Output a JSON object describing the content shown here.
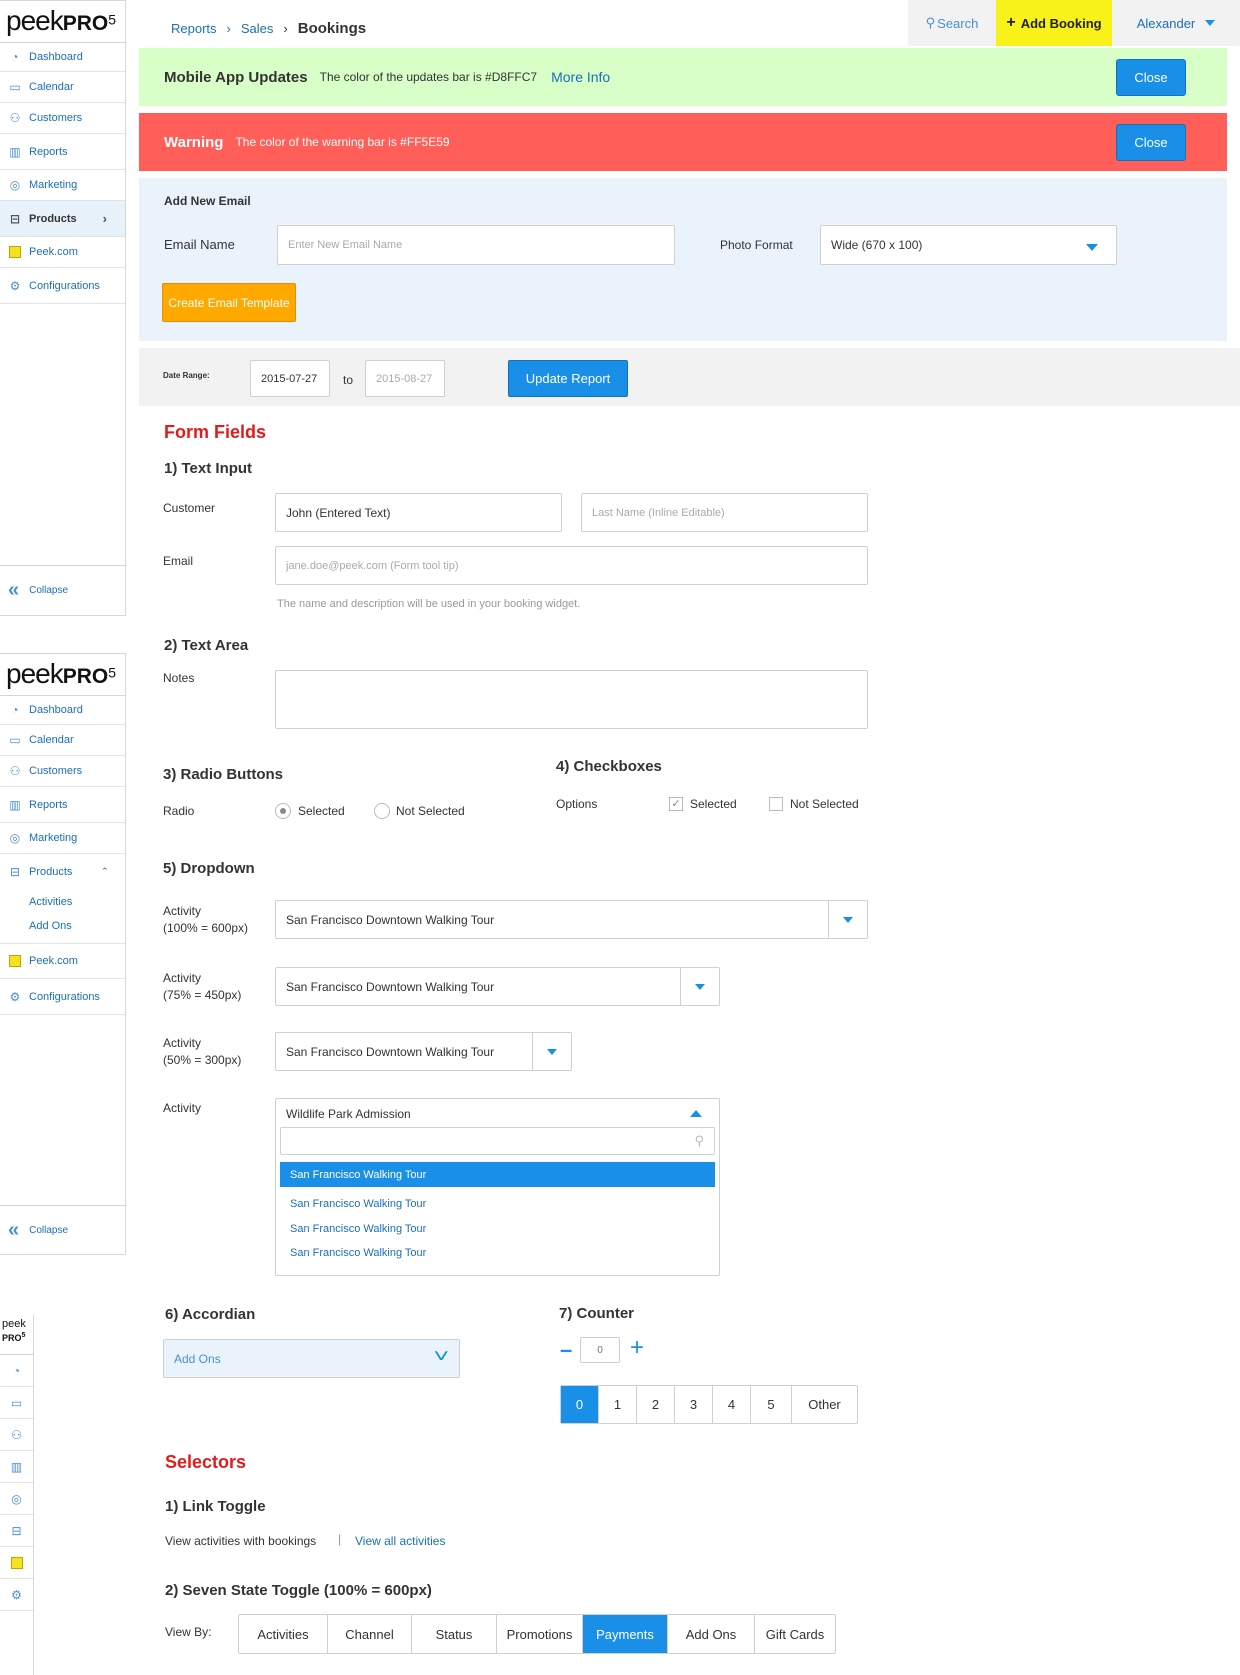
{
  "logo": {
    "peek": "peek",
    "pro": "PRO",
    "version": "5",
    "mini_peek": "peek",
    "mini_pro": "PRO"
  },
  "sidebar": {
    "items": [
      {
        "label": "Dashboard",
        "icon": "dashboard-icon"
      },
      {
        "label": "Calendar",
        "icon": "calendar-icon"
      },
      {
        "label": "Customers",
        "icon": "customers-icon"
      },
      {
        "label": "Reports",
        "icon": "reports-icon"
      },
      {
        "label": "Marketing",
        "icon": "marketing-icon"
      },
      {
        "label": "Products",
        "icon": "products-icon"
      },
      {
        "label": "Peek.com",
        "icon": "peek-com-icon"
      },
      {
        "label": "Configurations",
        "icon": "gear-icon"
      }
    ],
    "sub_items": [
      "Activities",
      "Add Ons"
    ],
    "collapse": "Collapse"
  },
  "breadcrumb": {
    "items": [
      "Reports",
      "Sales"
    ],
    "current": "Bookings"
  },
  "topbar": {
    "search": "Search",
    "add_booking": "Add Booking",
    "user": "Alexander"
  },
  "updates_bar": {
    "title": "Mobile App Updates",
    "message": "The color of the updates bar is #D8FFC7",
    "link": "More Info",
    "close": "Close",
    "color": "#D8FFC7"
  },
  "warning_bar": {
    "title": "Warning",
    "message": "The color of the warning bar is #FF5E59",
    "close": "Close",
    "color": "#FF5E59"
  },
  "add_email": {
    "title": "Add New Email",
    "name_label": "Email Name",
    "name_placeholder": "Enter New Email Name",
    "format_label": "Photo Format",
    "format_value": "Wide (670 x 100)",
    "create_button": "Create Email Template"
  },
  "date_range": {
    "label": "Date Range:",
    "from": "2015-07-27",
    "to_label": "to",
    "to": "2015-08-27",
    "update_button": "Update Report"
  },
  "form_fields": {
    "heading": "Form Fields",
    "text_input": {
      "title": "1) Text Input",
      "customer_label": "Customer",
      "first_value": "John (Entered Text)",
      "last_placeholder": "Last Name (Inline Editable)",
      "email_label": "Email",
      "email_placeholder": "jane.doe@peek.com (Form tool tip)",
      "help": "The name and description will be used in your booking widget."
    },
    "text_area": {
      "title": "2) Text Area",
      "label": "Notes"
    },
    "radio": {
      "title": "3) Radio Buttons",
      "label": "Radio",
      "selected": "Selected",
      "not_selected": "Not Selected"
    },
    "checkboxes": {
      "title": "4) Checkboxes",
      "label": "Options",
      "selected": "Selected",
      "not_selected": "Not Selected"
    },
    "dropdown": {
      "title": "5) Dropdown",
      "rows": [
        {
          "label": "Activity",
          "sub": "(100% = 600px)",
          "value": "San Francisco Downtown Walking Tour"
        },
        {
          "label": "Activity",
          "sub": "(75% = 450px)",
          "value": "San Francisco Downtown Walking Tour"
        },
        {
          "label": "Activity",
          "sub": "(50% = 300px)",
          "value": "San Francisco Downtown Walking Tour"
        }
      ],
      "open": {
        "label": "Activity",
        "value": "Wildlife Park Admission",
        "options": [
          "San Francisco Walking Tour",
          "San Francisco Walking Tour",
          "San Francisco Walking Tour",
          "San Francisco Walking Tour"
        ]
      }
    },
    "accordion": {
      "title": "6) Accordian",
      "value": "Add Ons"
    },
    "counter": {
      "title": "7) Counter",
      "value": "0",
      "options": [
        "0",
        "1",
        "2",
        "3",
        "4",
        "5",
        "Other"
      ],
      "selected_index": 0
    }
  },
  "selectors": {
    "heading": "Selectors",
    "link_toggle": {
      "title": "1) Link Toggle",
      "current": "View activities with bookings",
      "separator": "|",
      "link": "View all activities"
    },
    "seven_state": {
      "title": "2) Seven State Toggle (100% = 600px)",
      "label": "View By:",
      "options": [
        "Activities",
        "Channel",
        "Status",
        "Promotions",
        "Payments",
        "Add Ons",
        "Gift Cards"
      ],
      "selected_index": 4
    }
  },
  "colors": {
    "accent": "#1A8FE8",
    "add_booking": "#F8F21A",
    "orange": "#FFA800",
    "heading_red": "#E31B1B"
  }
}
